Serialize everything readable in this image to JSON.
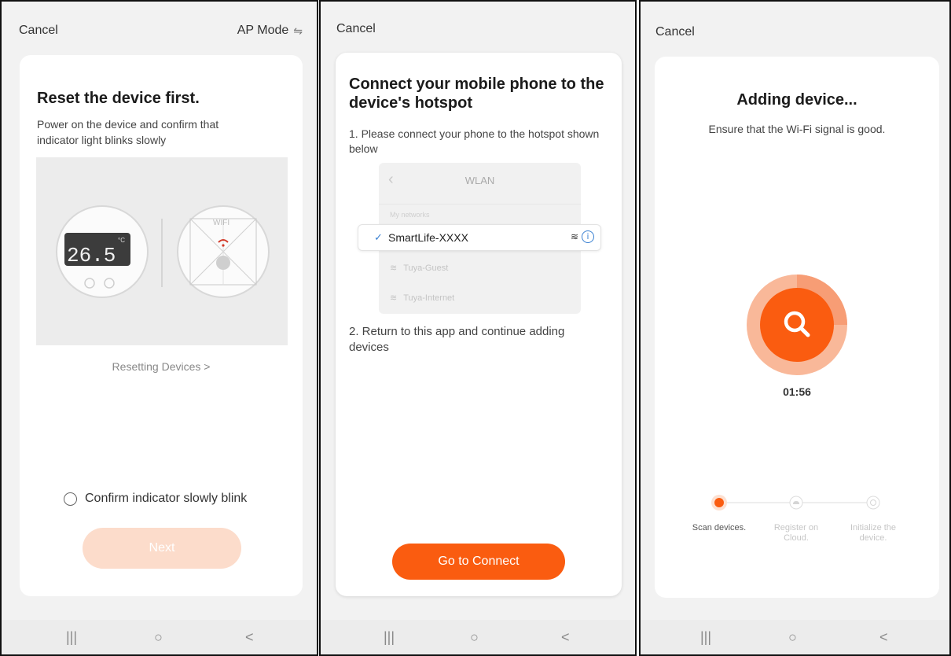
{
  "colors": {
    "accent": "#fa5c10",
    "accent_light": "#fcdccb",
    "info_blue": "#3a80d2"
  },
  "panel1": {
    "cancel": "Cancel",
    "mode": "AP Mode",
    "mode_icon": "swap-arrows-icon",
    "title": "Reset the device first.",
    "description": "Power on the device and confirm that indicator light blinks slowly",
    "display_reading": "26.5",
    "display_unit": "°C",
    "wifi_label": "WIFI",
    "resetting_link": "Resetting Devices >",
    "confirm_label": "Confirm indicator slowly blink",
    "confirm_checked": false,
    "next_label": "Next"
  },
  "panel2": {
    "cancel": "Cancel",
    "title": "Connect your mobile phone to the device's hotspot",
    "step1": "1. Please connect your phone to the hotspot shown below",
    "wlan": {
      "title": "WLAN",
      "section": "My networks",
      "selected": "SmartLife-XXXX",
      "others": [
        "Tuya-Guest",
        "Tuya-Internet"
      ]
    },
    "step2": "2. Return to this app and continue adding devices",
    "connect_label": "Go to Connect"
  },
  "panel3": {
    "cancel": "Cancel",
    "title": "Adding device...",
    "subtitle": "Ensure that the Wi-Fi signal is good.",
    "timer": "01:56",
    "steps": [
      {
        "label": "Scan devices.",
        "active": true
      },
      {
        "label": "Register on Cloud.",
        "active": false
      },
      {
        "label": "Initialize the device.",
        "active": false
      }
    ]
  },
  "navbar": {
    "recents": "|||",
    "home": "○",
    "back": "<"
  }
}
